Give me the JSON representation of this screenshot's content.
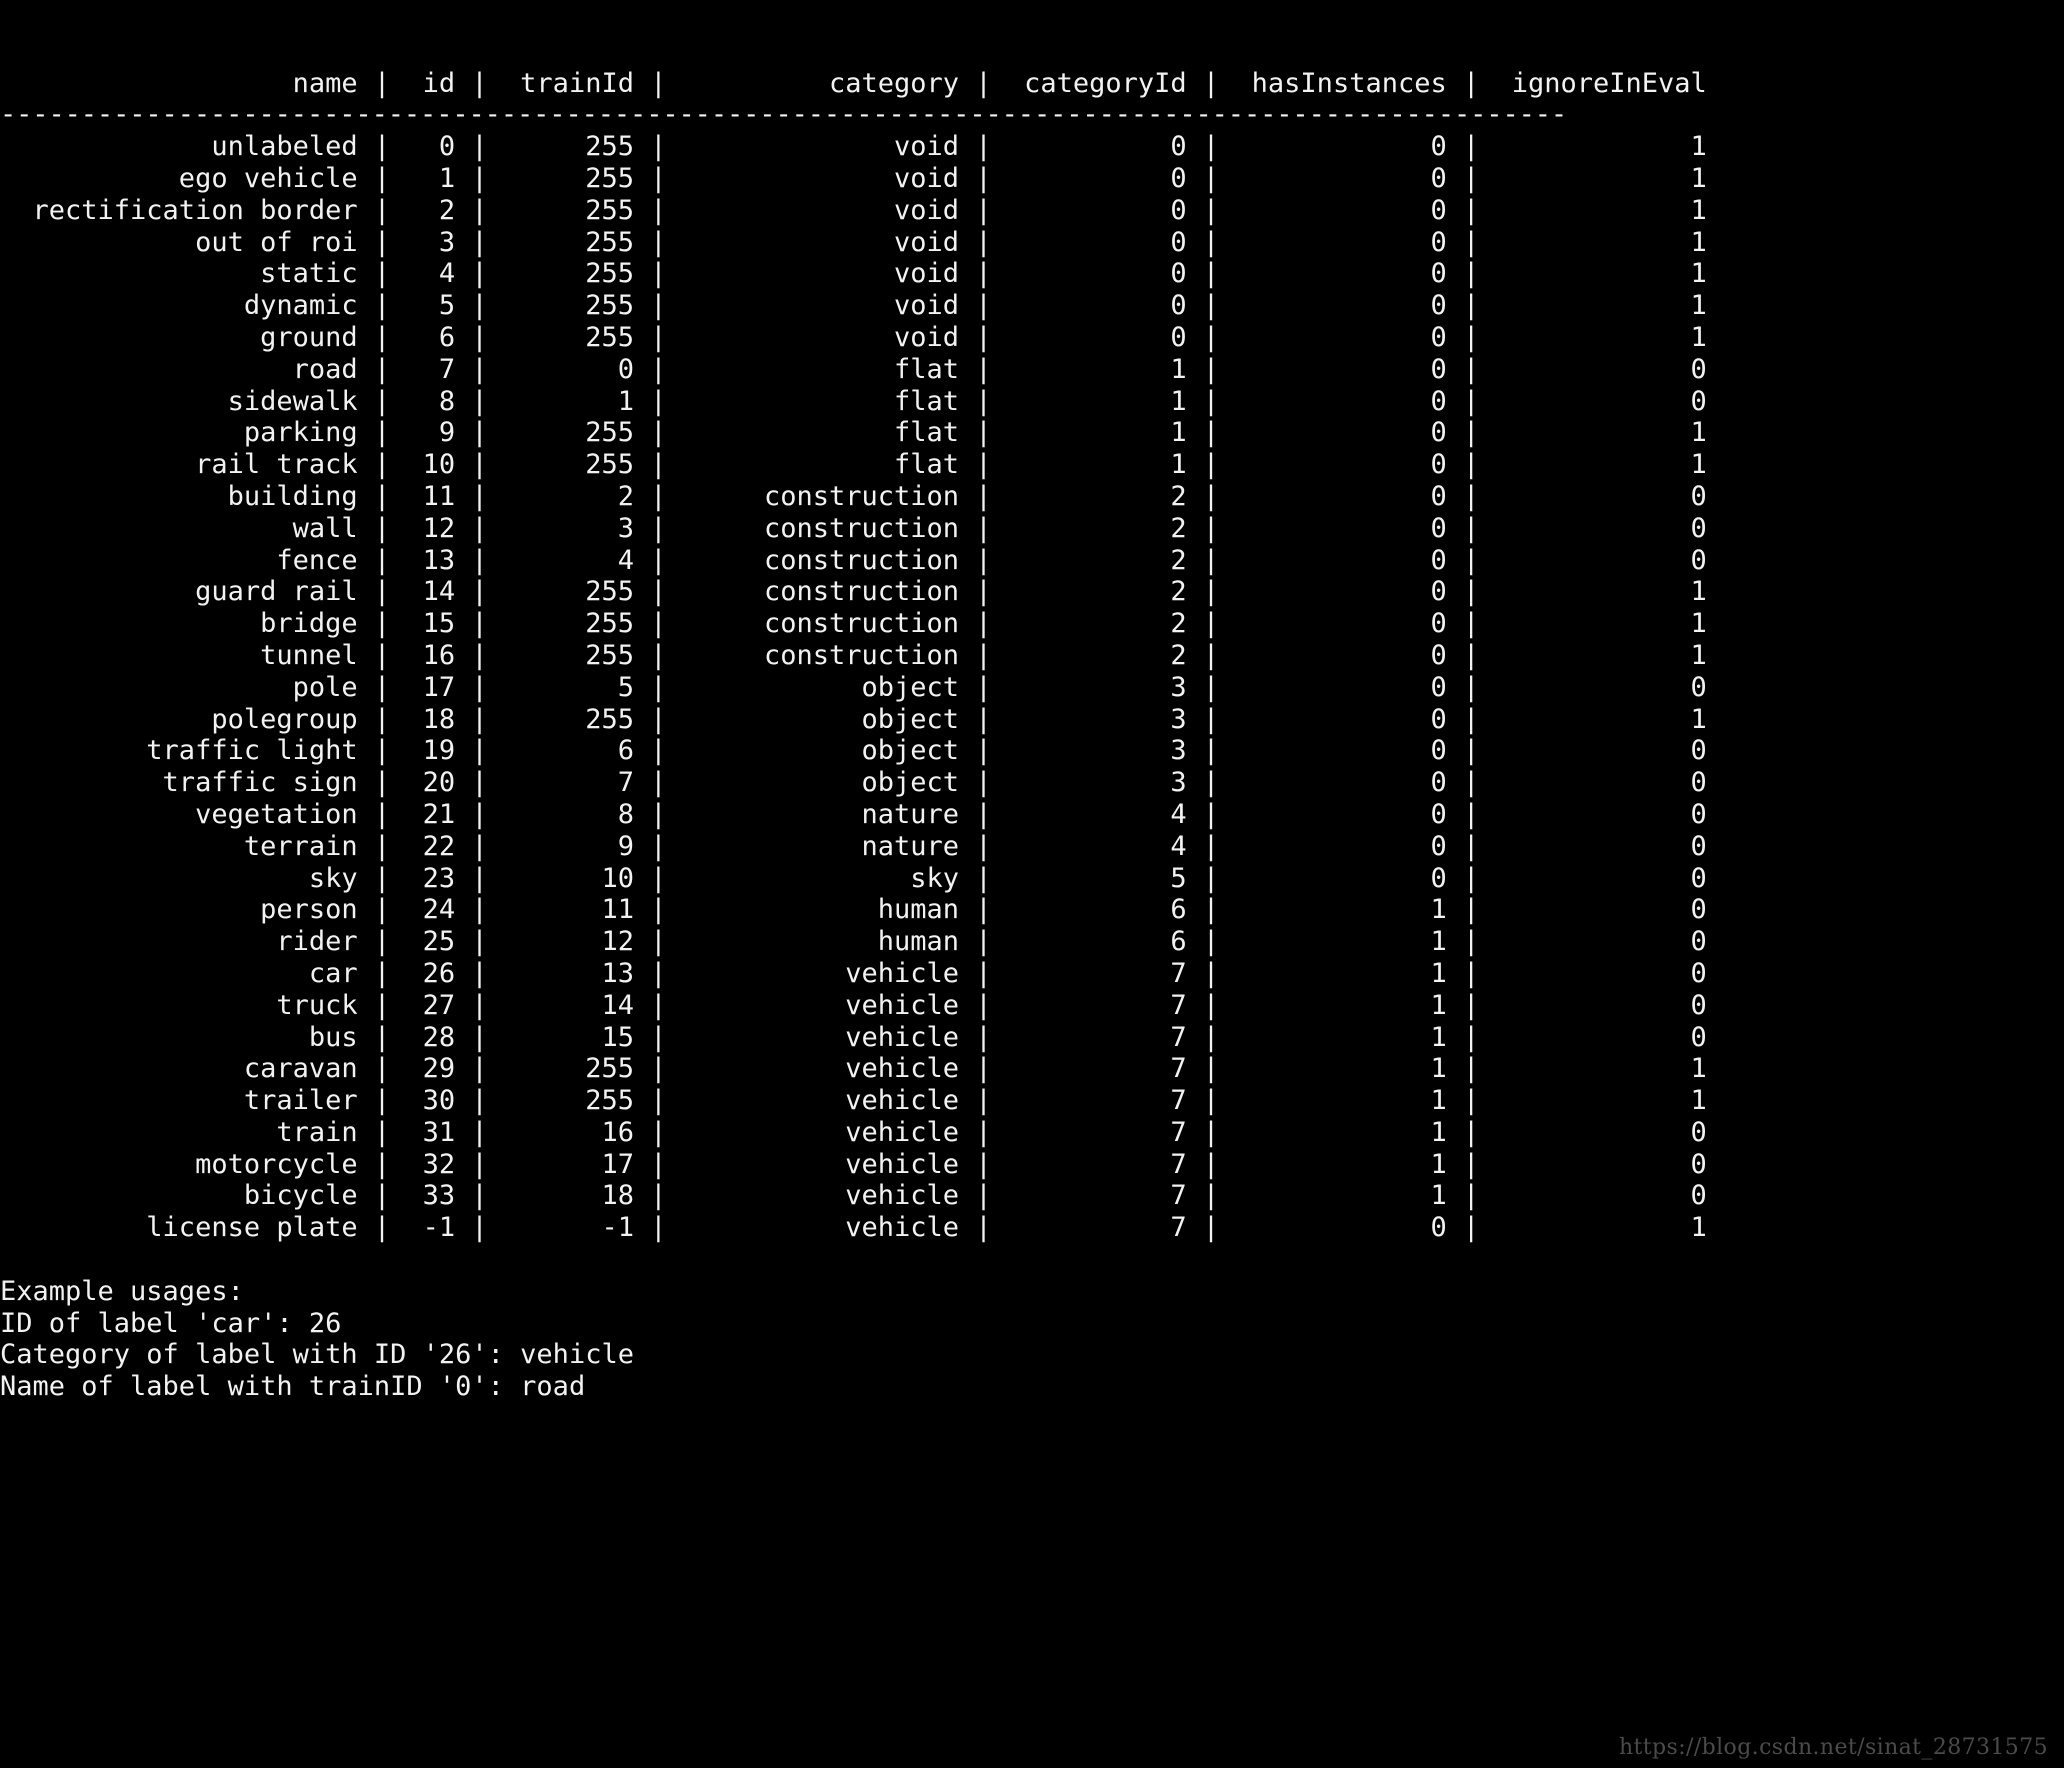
{
  "terminal": {
    "background_color": "#000000",
    "text_color": "#f2f2f2",
    "columns": {
      "name": "name",
      "id": "id",
      "trainId": "trainId",
      "category": "category",
      "categoryId": "categoryId",
      "hasInstances": "hasInstances",
      "ignoreInEval": "ignoreInEval"
    },
    "column_widths": {
      "name": 22,
      "id": 4,
      "trainId": 9,
      "category": 18,
      "categoryId": 12,
      "hasInstances": 14,
      "ignoreInEval": 14
    },
    "separator_char": "-",
    "separator_length": 97,
    "pipe": "|",
    "rows": [
      {
        "name": "unlabeled",
        "id": "0",
        "trainId": "255",
        "category": "void",
        "categoryId": "0",
        "hasInstances": "0",
        "ignoreInEval": "1"
      },
      {
        "name": "ego vehicle",
        "id": "1",
        "trainId": "255",
        "category": "void",
        "categoryId": "0",
        "hasInstances": "0",
        "ignoreInEval": "1"
      },
      {
        "name": "rectification border",
        "id": "2",
        "trainId": "255",
        "category": "void",
        "categoryId": "0",
        "hasInstances": "0",
        "ignoreInEval": "1"
      },
      {
        "name": "out of roi",
        "id": "3",
        "trainId": "255",
        "category": "void",
        "categoryId": "0",
        "hasInstances": "0",
        "ignoreInEval": "1"
      },
      {
        "name": "static",
        "id": "4",
        "trainId": "255",
        "category": "void",
        "categoryId": "0",
        "hasInstances": "0",
        "ignoreInEval": "1"
      },
      {
        "name": "dynamic",
        "id": "5",
        "trainId": "255",
        "category": "void",
        "categoryId": "0",
        "hasInstances": "0",
        "ignoreInEval": "1"
      },
      {
        "name": "ground",
        "id": "6",
        "trainId": "255",
        "category": "void",
        "categoryId": "0",
        "hasInstances": "0",
        "ignoreInEval": "1"
      },
      {
        "name": "road",
        "id": "7",
        "trainId": "0",
        "category": "flat",
        "categoryId": "1",
        "hasInstances": "0",
        "ignoreInEval": "0"
      },
      {
        "name": "sidewalk",
        "id": "8",
        "trainId": "1",
        "category": "flat",
        "categoryId": "1",
        "hasInstances": "0",
        "ignoreInEval": "0"
      },
      {
        "name": "parking",
        "id": "9",
        "trainId": "255",
        "category": "flat",
        "categoryId": "1",
        "hasInstances": "0",
        "ignoreInEval": "1"
      },
      {
        "name": "rail track",
        "id": "10",
        "trainId": "255",
        "category": "flat",
        "categoryId": "1",
        "hasInstances": "0",
        "ignoreInEval": "1"
      },
      {
        "name": "building",
        "id": "11",
        "trainId": "2",
        "category": "construction",
        "categoryId": "2",
        "hasInstances": "0",
        "ignoreInEval": "0"
      },
      {
        "name": "wall",
        "id": "12",
        "trainId": "3",
        "category": "construction",
        "categoryId": "2",
        "hasInstances": "0",
        "ignoreInEval": "0"
      },
      {
        "name": "fence",
        "id": "13",
        "trainId": "4",
        "category": "construction",
        "categoryId": "2",
        "hasInstances": "0",
        "ignoreInEval": "0"
      },
      {
        "name": "guard rail",
        "id": "14",
        "trainId": "255",
        "category": "construction",
        "categoryId": "2",
        "hasInstances": "0",
        "ignoreInEval": "1"
      },
      {
        "name": "bridge",
        "id": "15",
        "trainId": "255",
        "category": "construction",
        "categoryId": "2",
        "hasInstances": "0",
        "ignoreInEval": "1"
      },
      {
        "name": "tunnel",
        "id": "16",
        "trainId": "255",
        "category": "construction",
        "categoryId": "2",
        "hasInstances": "0",
        "ignoreInEval": "1"
      },
      {
        "name": "pole",
        "id": "17",
        "trainId": "5",
        "category": "object",
        "categoryId": "3",
        "hasInstances": "0",
        "ignoreInEval": "0"
      },
      {
        "name": "polegroup",
        "id": "18",
        "trainId": "255",
        "category": "object",
        "categoryId": "3",
        "hasInstances": "0",
        "ignoreInEval": "1"
      },
      {
        "name": "traffic light",
        "id": "19",
        "trainId": "6",
        "category": "object",
        "categoryId": "3",
        "hasInstances": "0",
        "ignoreInEval": "0"
      },
      {
        "name": "traffic sign",
        "id": "20",
        "trainId": "7",
        "category": "object",
        "categoryId": "3",
        "hasInstances": "0",
        "ignoreInEval": "0"
      },
      {
        "name": "vegetation",
        "id": "21",
        "trainId": "8",
        "category": "nature",
        "categoryId": "4",
        "hasInstances": "0",
        "ignoreInEval": "0"
      },
      {
        "name": "terrain",
        "id": "22",
        "trainId": "9",
        "category": "nature",
        "categoryId": "4",
        "hasInstances": "0",
        "ignoreInEval": "0"
      },
      {
        "name": "sky",
        "id": "23",
        "trainId": "10",
        "category": "sky",
        "categoryId": "5",
        "hasInstances": "0",
        "ignoreInEval": "0"
      },
      {
        "name": "person",
        "id": "24",
        "trainId": "11",
        "category": "human",
        "categoryId": "6",
        "hasInstances": "1",
        "ignoreInEval": "0"
      },
      {
        "name": "rider",
        "id": "25",
        "trainId": "12",
        "category": "human",
        "categoryId": "6",
        "hasInstances": "1",
        "ignoreInEval": "0"
      },
      {
        "name": "car",
        "id": "26",
        "trainId": "13",
        "category": "vehicle",
        "categoryId": "7",
        "hasInstances": "1",
        "ignoreInEval": "0"
      },
      {
        "name": "truck",
        "id": "27",
        "trainId": "14",
        "category": "vehicle",
        "categoryId": "7",
        "hasInstances": "1",
        "ignoreInEval": "0"
      },
      {
        "name": "bus",
        "id": "28",
        "trainId": "15",
        "category": "vehicle",
        "categoryId": "7",
        "hasInstances": "1",
        "ignoreInEval": "0"
      },
      {
        "name": "caravan",
        "id": "29",
        "trainId": "255",
        "category": "vehicle",
        "categoryId": "7",
        "hasInstances": "1",
        "ignoreInEval": "1"
      },
      {
        "name": "trailer",
        "id": "30",
        "trainId": "255",
        "category": "vehicle",
        "categoryId": "7",
        "hasInstances": "1",
        "ignoreInEval": "1"
      },
      {
        "name": "train",
        "id": "31",
        "trainId": "16",
        "category": "vehicle",
        "categoryId": "7",
        "hasInstances": "1",
        "ignoreInEval": "0"
      },
      {
        "name": "motorcycle",
        "id": "32",
        "trainId": "17",
        "category": "vehicle",
        "categoryId": "7",
        "hasInstances": "1",
        "ignoreInEval": "0"
      },
      {
        "name": "bicycle",
        "id": "33",
        "trainId": "18",
        "category": "vehicle",
        "categoryId": "7",
        "hasInstances": "1",
        "ignoreInEval": "0"
      },
      {
        "name": "license plate",
        "id": "-1",
        "trainId": "-1",
        "category": "vehicle",
        "categoryId": "7",
        "hasInstances": "0",
        "ignoreInEval": "1"
      }
    ],
    "examples": {
      "heading": "Example usages:",
      "lines": [
        "ID of label 'car': 26",
        "Category of label with ID '26': vehicle",
        "Name of label with trainID '0': road"
      ]
    }
  },
  "watermark": {
    "text": "https://blog.csdn.net/sinat_28731575",
    "color": "#4b4b4b"
  }
}
